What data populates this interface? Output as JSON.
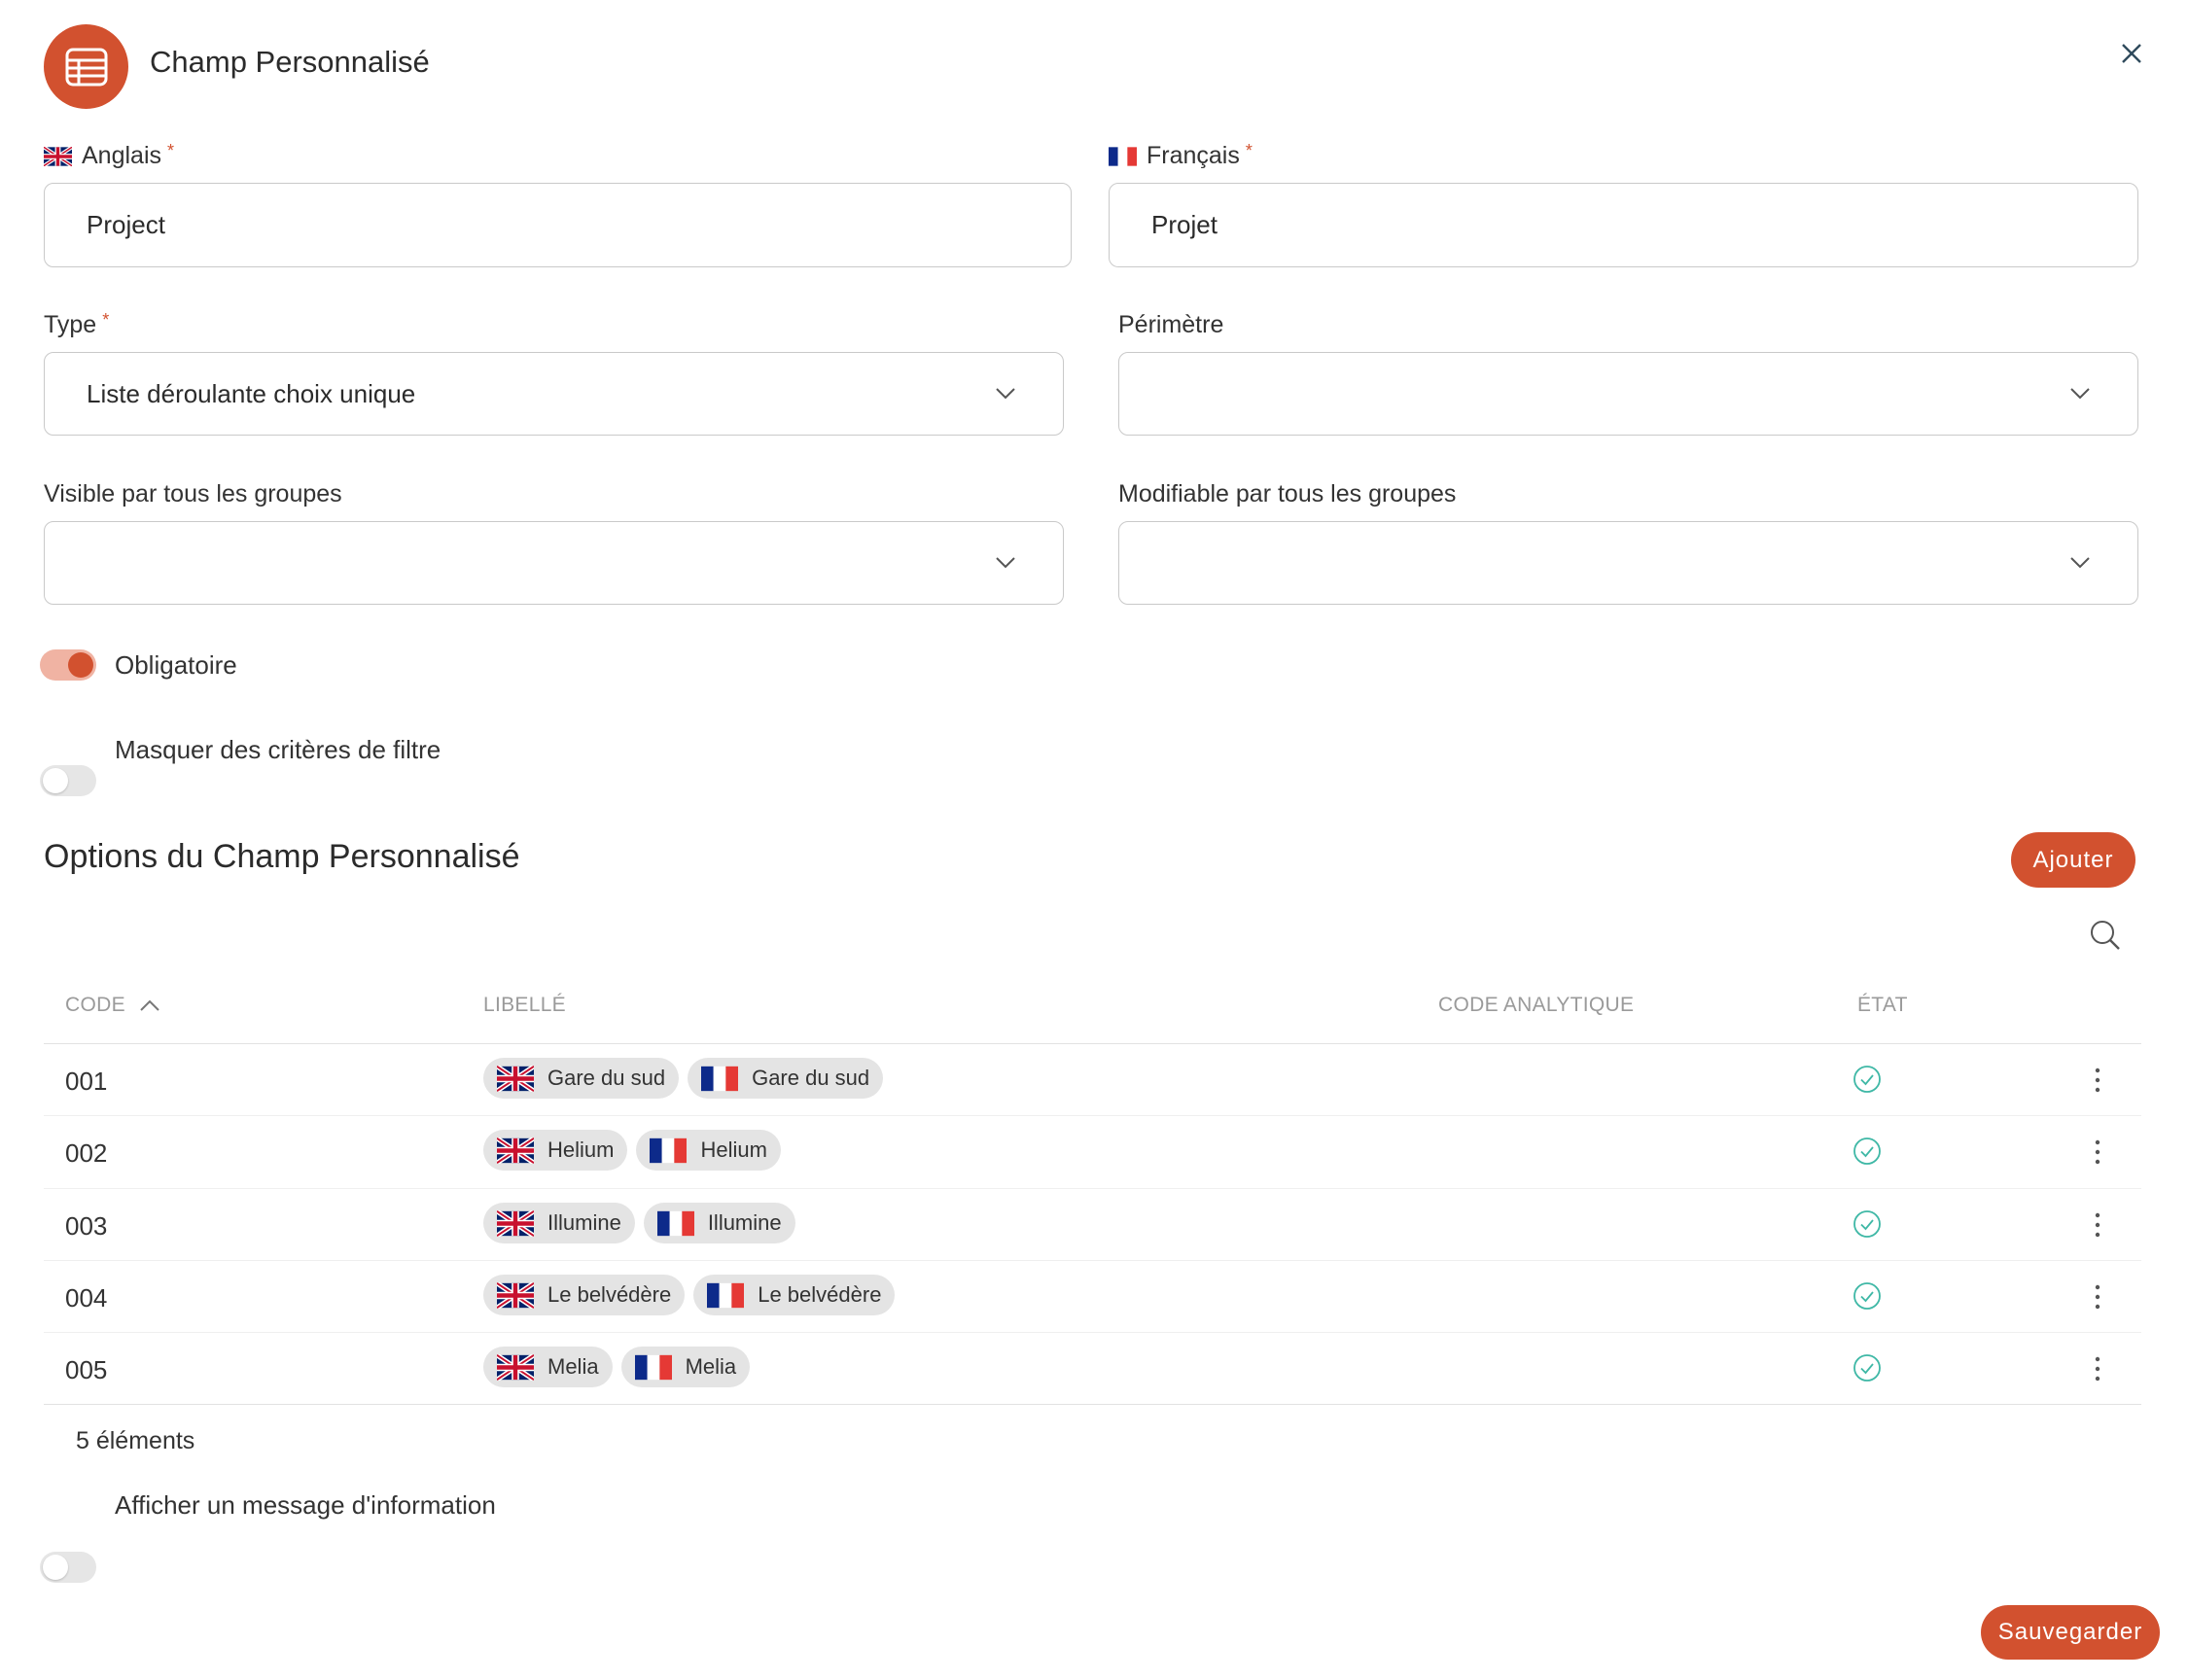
{
  "header": {
    "title": "Champ Personnalisé",
    "icon": "table-icon"
  },
  "fields": {
    "english_label": "Anglais",
    "english_value": "Project",
    "french_label": "Français",
    "french_value": "Projet",
    "required_marker": "*",
    "type_label": "Type",
    "type_value": "Liste déroulante choix unique",
    "perimeter_label": "Périmètre",
    "perimeter_value": "",
    "visible_label": "Visible par tous les groupes",
    "visible_value": "",
    "editable_label": "Modifiable par tous les groupes",
    "editable_value": ""
  },
  "toggles": {
    "mandatory": {
      "label": "Obligatoire",
      "on": true
    },
    "hide_filter": {
      "label": "Masquer des critères de filtre",
      "on": false
    },
    "info_message": {
      "label": "Afficher un message d'information",
      "on": false
    }
  },
  "options": {
    "title": "Options du Champ Personnalisé",
    "add_button": "Ajouter",
    "columns": {
      "code": "CODE",
      "label": "LIBELLÉ",
      "analytic": "CODE ANALYTIQUE",
      "state": "ÉTAT"
    },
    "rows": [
      {
        "code": "001",
        "en": "Gare du sud",
        "fr": "Gare du sud",
        "analytic": "",
        "state": "active"
      },
      {
        "code": "002",
        "en": "Helium",
        "fr": "Helium",
        "analytic": "",
        "state": "active"
      },
      {
        "code": "003",
        "en": "Illumine",
        "fr": "Illumine",
        "analytic": "",
        "state": "active"
      },
      {
        "code": "004",
        "en": "Le belvédère",
        "fr": "Le belvédère",
        "analytic": "",
        "state": "active"
      },
      {
        "code": "005",
        "en": "Melia",
        "fr": "Melia",
        "analytic": "",
        "state": "active"
      }
    ],
    "count": "5 éléments"
  },
  "footer": {
    "save_button": "Sauvegarder"
  },
  "colors": {
    "accent": "#d2512f",
    "accent_light": "#f0b3a3",
    "status_ok": "#3fb8a6"
  }
}
